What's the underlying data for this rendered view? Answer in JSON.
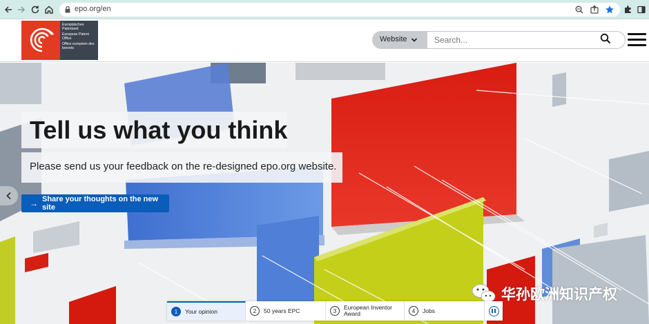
{
  "browser": {
    "url": "epo.org/en",
    "icons": [
      "back-arrow-icon",
      "forward-arrow-icon",
      "reload-icon",
      "home-icon",
      "site-info-icon",
      "zoom-icon",
      "share-icon",
      "bookmark-star-icon",
      "extensions-icon",
      "side-panel-icon"
    ]
  },
  "header": {
    "logo_lines": [
      "Europäisches Patentamt",
      "European Patent Office",
      "Office européen des brevets"
    ],
    "scope_label": "Website",
    "search_placeholder": "Search..."
  },
  "hero": {
    "title": "Tell us what you think",
    "subtitle": "Please send us your feedback on the re-designed epo.org website.",
    "cta_label": "Share your thoughts on the new site"
  },
  "slider": {
    "tabs": [
      {
        "num": "1",
        "label": "Your opinion",
        "active": true
      },
      {
        "num": "2",
        "label": "50 years EPC",
        "active": false
      },
      {
        "num": "3",
        "label": "European Inventor Award",
        "active": false
      },
      {
        "num": "4",
        "label": "Jobs",
        "active": false
      }
    ]
  },
  "watermark": {
    "text": "华孙欧洲知识产权"
  },
  "colors": {
    "accent": "#0a5db9",
    "logo_red": "#e33a22",
    "logo_dark": "#3c4450",
    "browser_bar": "#d4ece9"
  }
}
